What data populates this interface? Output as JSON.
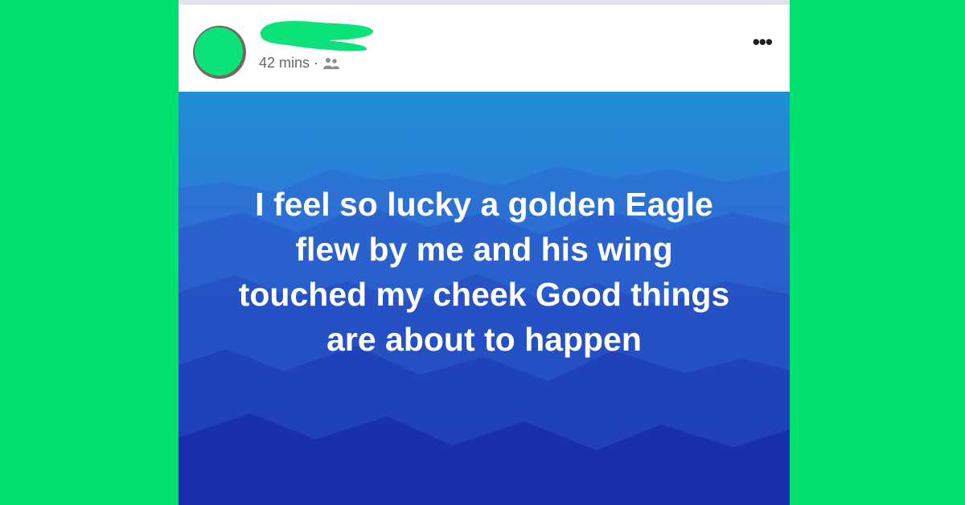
{
  "post": {
    "timestamp": "42 mins",
    "separator": "·",
    "privacy_icon": "friends-icon",
    "more_icon": "more-options-icon",
    "more_label": "•••",
    "text": "I feel so lucky a golden Eagle flew by me and his wing touched my cheek Good things are about to happen",
    "background_theme": "blue-mountains"
  },
  "colors": {
    "page_background": "#00e06e",
    "redaction": "#0be37a",
    "text": "#ffffff",
    "meta_text": "#65676b"
  }
}
